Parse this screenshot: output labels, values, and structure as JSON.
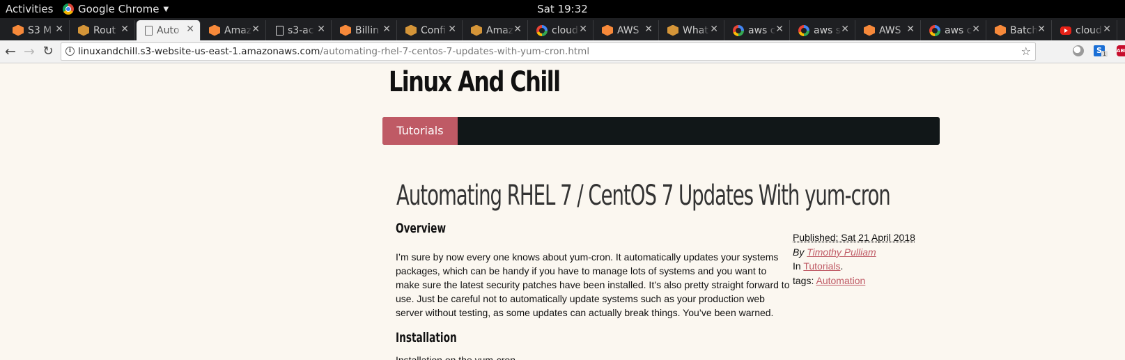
{
  "system": {
    "activities": "Activities",
    "app_name": "Google Chrome",
    "clock": "Sat 19:32"
  },
  "tabs": [
    {
      "label": "S3 M",
      "icon": "aws-icon"
    },
    {
      "label": "Rout",
      "icon": "box-icon"
    },
    {
      "label": "Auto",
      "icon": "page-icon",
      "active": true
    },
    {
      "label": "Amaz",
      "icon": "aws-icon"
    },
    {
      "label": "s3-ac",
      "icon": "page-icon"
    },
    {
      "label": "Billin",
      "icon": "aws-icon"
    },
    {
      "label": "Confi",
      "icon": "box-icon"
    },
    {
      "label": "Amaz",
      "icon": "box-icon"
    },
    {
      "label": "cloud",
      "icon": "google-icon"
    },
    {
      "label": "AWS",
      "icon": "aws-icon"
    },
    {
      "label": "What",
      "icon": "box-icon"
    },
    {
      "label": "aws c",
      "icon": "google-icon"
    },
    {
      "label": "aws s",
      "icon": "google-icon"
    },
    {
      "label": "AWS",
      "icon": "aws-icon"
    },
    {
      "label": "aws c",
      "icon": "google-icon"
    },
    {
      "label": "Batch",
      "icon": "aws-icon"
    },
    {
      "label": "cloud",
      "icon": "youtube-icon"
    }
  ],
  "toolbar": {
    "url_host": "linuxandchill.s3-website-us-east-1.amazonaws.com",
    "url_path": "/automating-rhel-7-centos-7-updates-with-yum-cron.html",
    "ext_badge": "1"
  },
  "site": {
    "title": "Linux And Chill",
    "nav_item": "Tutorials"
  },
  "post": {
    "title": "Automating RHEL 7 / CentOS 7 Updates With yum-cron",
    "overview_heading": "Overview",
    "paragraph": "I’m sure by now every one knows about yum-cron. It automatically updates your systems packages, which can be handy if you have to manage lots of systems and you want to make sure the latest security patches have been installed. It’s also pretty straight forward to use. Just be careful not to automatically update systems such as your production web server without testing, as some updates can actually break things. You’ve been warned.",
    "install_heading": "Installation",
    "cut_text": "Installation on the yum-cron"
  },
  "meta": {
    "published": "Published: Sat 21 April 2018",
    "by_prefix": "By",
    "author": "Timothy Pulliam",
    "in_prefix": "In",
    "category": "Tutorials",
    "in_suffix": ".",
    "tags_prefix": "tags:",
    "tag": "Automation"
  },
  "colors": {
    "accent": "#bf5a65",
    "navbar": "#111718",
    "page_bg": "#fbf7f0"
  }
}
